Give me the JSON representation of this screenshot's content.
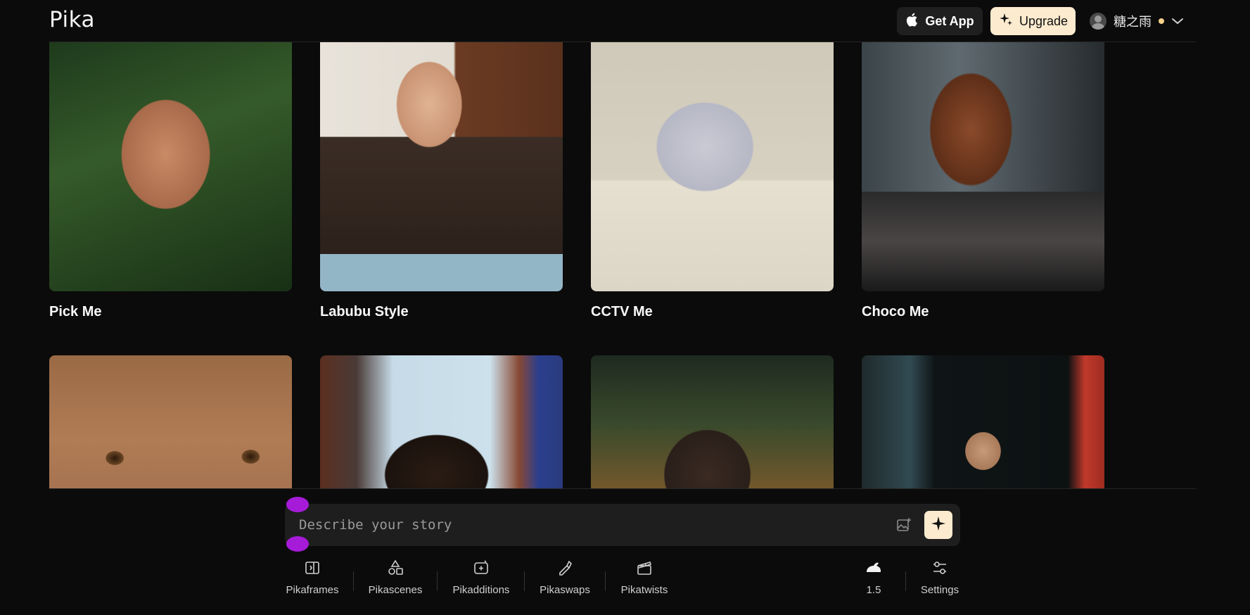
{
  "header": {
    "logo": "Pika",
    "get_app_label": "Get App",
    "upgrade_label": "Upgrade",
    "username": "糖之雨"
  },
  "effects": [
    {
      "title": "Pick Me"
    },
    {
      "title": "Labubu Style"
    },
    {
      "title": "CCTV Me"
    },
    {
      "title": "Choco Me"
    }
  ],
  "prompt": {
    "placeholder": "Describe your story"
  },
  "toolbar": {
    "pikaframes": "Pikaframes",
    "pikascenes": "Pikascenes",
    "pikadditions": "Pikadditions",
    "pikaswaps": "Pikaswaps",
    "pikatwists": "Pikatwists",
    "model_version": "1.5",
    "settings": "Settings"
  },
  "icons": {
    "get_app": "apple-icon",
    "upgrade": "sparkle-icon",
    "account": "chevron-down-icon",
    "generate": "sparkle-icon",
    "attach": "image-add-icon"
  },
  "colors": {
    "background": "#0b0b0b",
    "accent": "#fdebcf",
    "handle": "#a51bd8",
    "status_dot": "#f7d08a"
  }
}
